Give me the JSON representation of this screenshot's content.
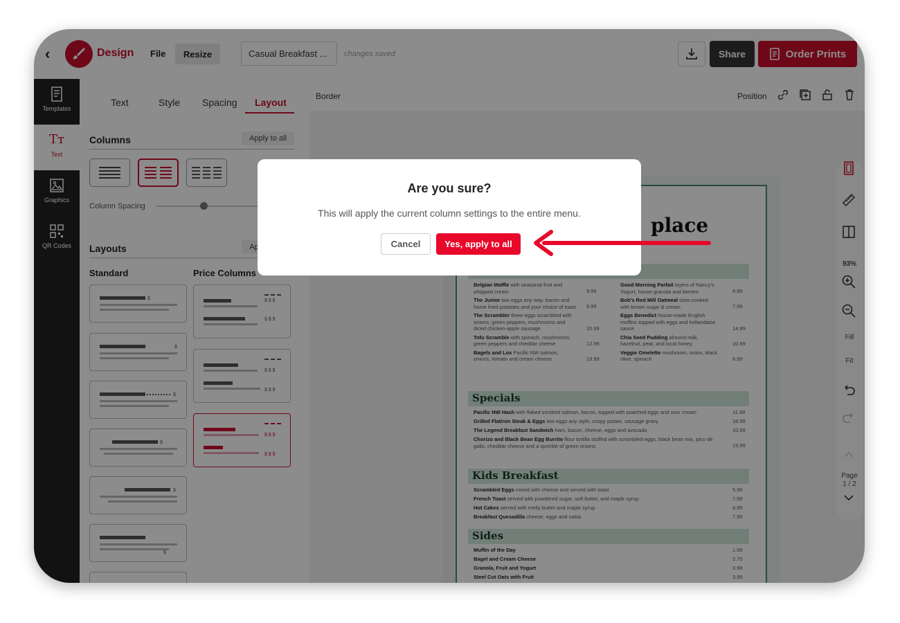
{
  "topbar": {
    "app_name": "Design",
    "file_label": "File",
    "resize_label": "Resize",
    "document_title": "Casual Breakfast ...",
    "save_status": "changes saved",
    "share_label": "Share",
    "order_label": "Order Prints"
  },
  "rail": {
    "items": [
      {
        "label": "Templates",
        "icon": "templates-icon"
      },
      {
        "label": "Text",
        "icon": "text-icon"
      },
      {
        "label": "Graphics",
        "icon": "graphics-icon"
      },
      {
        "label": "QR Codes",
        "icon": "qr-code-icon"
      }
    ]
  },
  "panel": {
    "tabs": [
      "Text",
      "Style",
      "Spacing",
      "Layout"
    ],
    "active_tab": "Layout",
    "columns_title": "Columns",
    "apply_to_all": "Apply to all",
    "column_spacing_label": "Column Spacing",
    "layouts_title": "Layouts",
    "apply_to_all_short": "Ap",
    "standard_title": "Standard",
    "price_columns_title": "Price Columns"
  },
  "workspace": {
    "toolbar_label": "Border",
    "position_label": "Position",
    "zoom": "93%",
    "fill_label": "Fill",
    "fit_label": "Fit",
    "page_label": "Page",
    "page_count": "1 / 2"
  },
  "menu_doc": {
    "heading": "place",
    "sections": [
      "Specials",
      "Kids Breakfast",
      "Sides"
    ],
    "col1": [
      {
        "name": "Belgian Waffle",
        "desc": "with seasonal fruit and whipped cream",
        "price": "9.99"
      },
      {
        "name": "The Junior",
        "desc": "two eggs any way, bacon and home fried potatoes and your choice of toast",
        "price": "8.99"
      },
      {
        "name": "The Scrambler",
        "desc": "three eggs scrambled with onions, green peppers, mushrooms and diced chicken-apple sausage",
        "price": "10.99"
      },
      {
        "name": "Tofu Scramble",
        "desc": "with spinach, mushrooms, green peppers and cheddar cheese",
        "price": "12.99"
      },
      {
        "name": "Bagels and Lox",
        "desc": "Pacific NW salmon, onions, tomato and cream cheese",
        "price": "13.99"
      }
    ],
    "col2": [
      {
        "name": "Good Morning Parfait",
        "desc": "layers of Nancy's Yogurt, house granola and berries",
        "price": "8.99"
      },
      {
        "name": "Bob's Red Mill Oatmeal",
        "desc": "slow-cooked with brown sugar & cream",
        "price": "7.99"
      },
      {
        "name": "Eggs Benedict",
        "desc": "house-made English muffins topped with eggs and hollandaise sauce",
        "price": "14.99"
      },
      {
        "name": "Chia Seed Pudding",
        "desc": "almond milk, hazelnut, pear, and local honey",
        "price": "10.99"
      },
      {
        "name": "Veggie Omelette",
        "desc": "mushroom, onion, black olive, spinach",
        "price": "6.99"
      }
    ],
    "specials": [
      {
        "name": "Pacific NW Hash",
        "desc": "with flaked smoked salmon, bacon, topped with poached eggs and sour cream",
        "price": "11.99"
      },
      {
        "name": "Grilled Flatiron Steak & Eggs",
        "desc": "two eggs any style, crispy potato, sausage gravy",
        "price": "18.99"
      },
      {
        "name": "The Legend Breakfast Sandwich",
        "desc": "ham, bacon, cheese, eggs and avocado",
        "price": "10.99"
      },
      {
        "name": "Chorizo and Black Bean Egg Burrito",
        "desc": "flour tortilla stuffed with scrambled eggs, black bean mix, pico de gallo, cheddar cheese and a sprinkle of green onions",
        "price": "13.99"
      }
    ],
    "kids": [
      {
        "name": "Scrambled Eggs",
        "desc": "mixed with cheese and served with toast",
        "price": "5.99"
      },
      {
        "name": "French Toast",
        "desc": "served with powdered sugar, soft butter, and maple syrup",
        "price": "7.99"
      },
      {
        "name": "Hot Cakes",
        "desc": "served with melty butter and maple syrup",
        "price": "6.99"
      },
      {
        "name": "Breakfast Quesadilla",
        "desc": "cheese, eggs and salsa",
        "price": "7.99"
      }
    ],
    "sides": [
      {
        "name": "Muffin of the Day",
        "desc": "",
        "price": "1.99"
      },
      {
        "name": "Bagel and Cream Cheese",
        "desc": "",
        "price": "2.75"
      },
      {
        "name": "Granola, Fruit and Yogurt",
        "desc": "",
        "price": "3.99"
      },
      {
        "name": "Steel Cut Oats with Fruit",
        "desc": "",
        "price": "3.99"
      }
    ]
  },
  "dialog": {
    "title": "Are you sure?",
    "message": "This will apply the current column settings to the entire menu.",
    "cancel_label": "Cancel",
    "confirm_label": "Yes, apply to all"
  },
  "colors": {
    "brand": "#c8102e",
    "confirm": "#e8082a",
    "menu_green": "#4d8a6c",
    "menu_section_bg": "#cfe7dc"
  }
}
